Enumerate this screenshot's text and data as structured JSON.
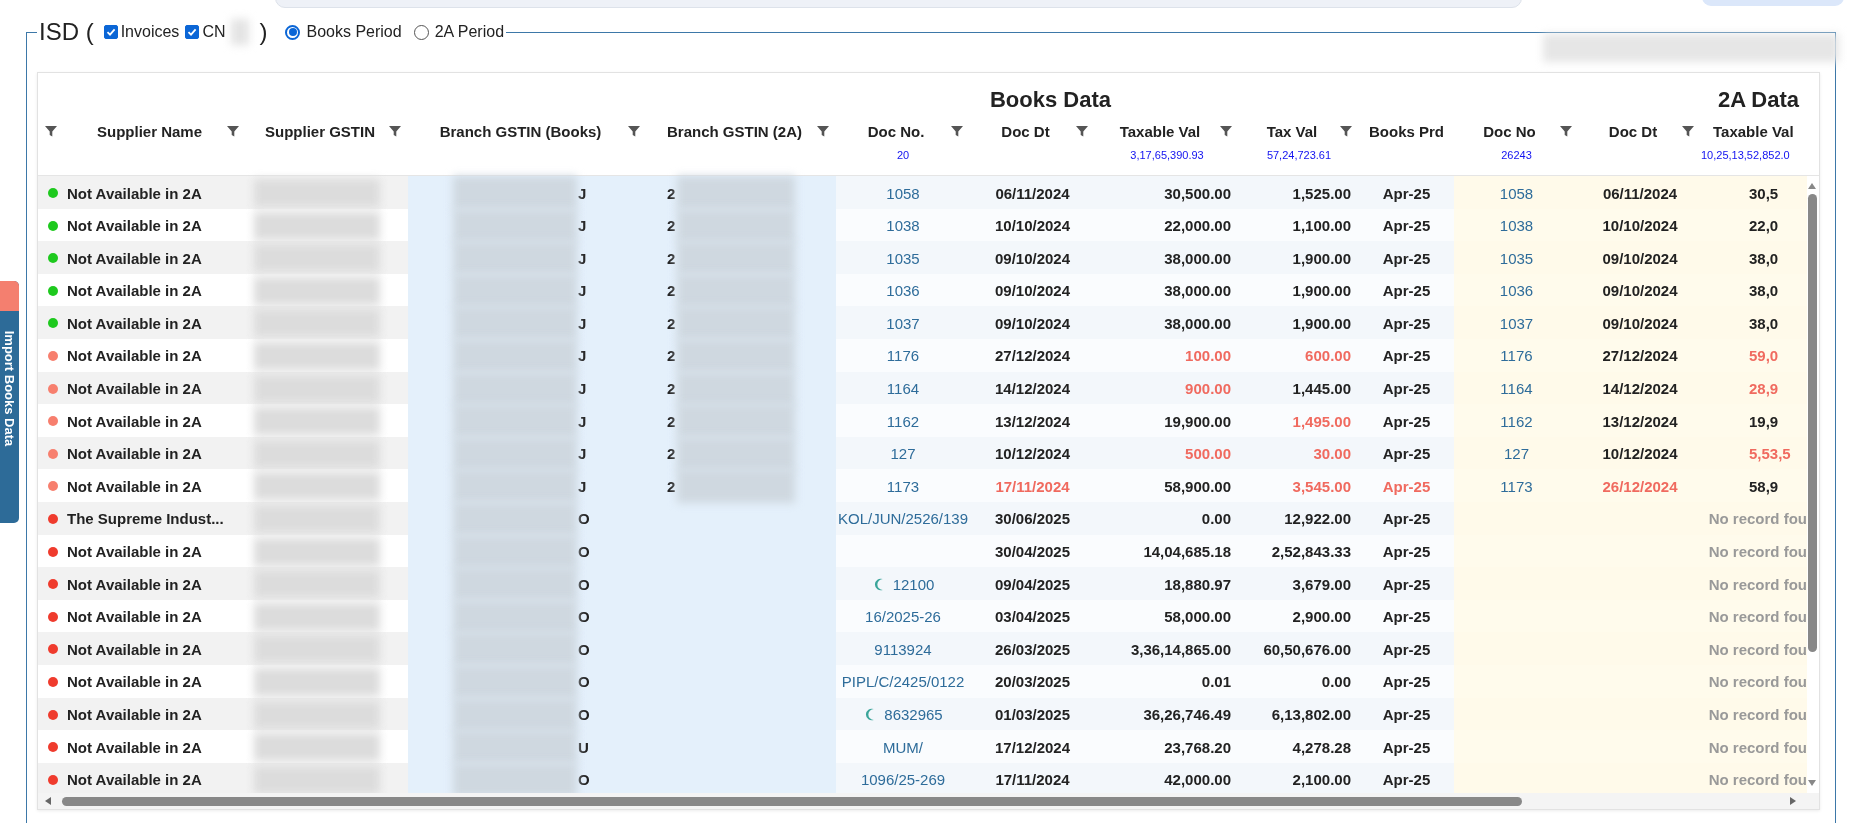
{
  "legend": {
    "title": "ISD (",
    "close": ")",
    "checkboxes": [
      {
        "label": "Invoices",
        "checked": true
      },
      {
        "label": "CN",
        "checked": true
      }
    ],
    "radios": [
      {
        "label": "Books Period",
        "selected": true
      },
      {
        "label": "2A Period",
        "selected": false
      }
    ]
  },
  "side_tab": {
    "label": "Import Books Data"
  },
  "groups": [
    "Books Data",
    "2A Data"
  ],
  "columns": [
    {
      "filter": true
    },
    {
      "label": "Supplier Name",
      "filter": true
    },
    {
      "label": "Supplier GSTIN",
      "filter": true
    },
    {
      "label": "Branch GSTIN (Books)",
      "filter": true
    },
    {
      "label": "Branch GSTIN (2A)",
      "filter": true
    },
    {
      "label": "Doc No.",
      "filter": true,
      "total": "20"
    },
    {
      "label": "Doc Dt",
      "filter": true
    },
    {
      "label": "Taxable Val",
      "filter": true,
      "total": "3,17,65,390.93"
    },
    {
      "label": "Tax Val",
      "filter": true,
      "total": "57,24,723.61"
    },
    {
      "label": "Books Prd",
      "filter": false
    },
    {
      "label": "Doc No",
      "filter": true,
      "total": "26243"
    },
    {
      "label": "Doc Dt",
      "filter": true
    },
    {
      "label": "Taxable Val",
      "filter": false,
      "total": "10,25,13,52,852.0"
    }
  ],
  "rows": [
    {
      "color": "#1ec91e",
      "name": "Not Available in 2A",
      "branch_books_tail": "J",
      "branch_2a_head": "2",
      "doc_no": "1058",
      "flag": false,
      "doc_dt": {
        "text": "06/11/2024",
        "mismatch": false
      },
      "taxable": {
        "text": "30,500.00",
        "mismatch": false
      },
      "tax": {
        "text": "1,525.00",
        "mismatch": false
      },
      "prd": {
        "text": "Apr-25",
        "mismatch": false
      },
      "twoa": {
        "doc_no": "1058",
        "doc_dt": {
          "text": "06/11/2024",
          "mismatch": false
        },
        "taxable": {
          "text": "30,5",
          "mismatch": false
        }
      }
    },
    {
      "color": "#1ec91e",
      "name": "Not Available in 2A",
      "branch_books_tail": "J",
      "branch_2a_head": "2",
      "doc_no": "1038",
      "flag": false,
      "doc_dt": {
        "text": "10/10/2024",
        "mismatch": false
      },
      "taxable": {
        "text": "22,000.00",
        "mismatch": false
      },
      "tax": {
        "text": "1,100.00",
        "mismatch": false
      },
      "prd": {
        "text": "Apr-25",
        "mismatch": false
      },
      "twoa": {
        "doc_no": "1038",
        "doc_dt": {
          "text": "10/10/2024",
          "mismatch": false
        },
        "taxable": {
          "text": "22,0",
          "mismatch": false
        }
      }
    },
    {
      "color": "#1ec91e",
      "name": "Not Available in 2A",
      "branch_books_tail": "J",
      "branch_2a_head": "2",
      "doc_no": "1035",
      "flag": false,
      "doc_dt": {
        "text": "09/10/2024",
        "mismatch": false
      },
      "taxable": {
        "text": "38,000.00",
        "mismatch": false
      },
      "tax": {
        "text": "1,900.00",
        "mismatch": false
      },
      "prd": {
        "text": "Apr-25",
        "mismatch": false
      },
      "twoa": {
        "doc_no": "1035",
        "doc_dt": {
          "text": "09/10/2024",
          "mismatch": false
        },
        "taxable": {
          "text": "38,0",
          "mismatch": false
        }
      }
    },
    {
      "color": "#1ec91e",
      "name": "Not Available in 2A",
      "branch_books_tail": "J",
      "branch_2a_head": "2",
      "doc_no": "1036",
      "flag": false,
      "doc_dt": {
        "text": "09/10/2024",
        "mismatch": false
      },
      "taxable": {
        "text": "38,000.00",
        "mismatch": false
      },
      "tax": {
        "text": "1,900.00",
        "mismatch": false
      },
      "prd": {
        "text": "Apr-25",
        "mismatch": false
      },
      "twoa": {
        "doc_no": "1036",
        "doc_dt": {
          "text": "09/10/2024",
          "mismatch": false
        },
        "taxable": {
          "text": "38,0",
          "mismatch": false
        }
      }
    },
    {
      "color": "#1ec91e",
      "name": "Not Available in 2A",
      "branch_books_tail": "J",
      "branch_2a_head": "2",
      "doc_no": "1037",
      "flag": false,
      "doc_dt": {
        "text": "09/10/2024",
        "mismatch": false
      },
      "taxable": {
        "text": "38,000.00",
        "mismatch": false
      },
      "tax": {
        "text": "1,900.00",
        "mismatch": false
      },
      "prd": {
        "text": "Apr-25",
        "mismatch": false
      },
      "twoa": {
        "doc_no": "1037",
        "doc_dt": {
          "text": "09/10/2024",
          "mismatch": false
        },
        "taxable": {
          "text": "38,0",
          "mismatch": false
        }
      }
    },
    {
      "color": "#f77f6e",
      "name": "Not Available in 2A",
      "branch_books_tail": "J",
      "branch_2a_head": "2",
      "doc_no": "1176",
      "flag": false,
      "doc_dt": {
        "text": "27/12/2024",
        "mismatch": false
      },
      "taxable": {
        "text": "100.00",
        "mismatch": true
      },
      "tax": {
        "text": "600.00",
        "mismatch": true
      },
      "prd": {
        "text": "Apr-25",
        "mismatch": false
      },
      "twoa": {
        "doc_no": "1176",
        "doc_dt": {
          "text": "27/12/2024",
          "mismatch": false
        },
        "taxable": {
          "text": "59,0",
          "mismatch": true
        }
      }
    },
    {
      "color": "#f77f6e",
      "name": "Not Available in 2A",
      "branch_books_tail": "J",
      "branch_2a_head": "2",
      "doc_no": "1164",
      "flag": false,
      "doc_dt": {
        "text": "14/12/2024",
        "mismatch": false
      },
      "taxable": {
        "text": "900.00",
        "mismatch": true
      },
      "tax": {
        "text": "1,445.00",
        "mismatch": false
      },
      "prd": {
        "text": "Apr-25",
        "mismatch": false
      },
      "twoa": {
        "doc_no": "1164",
        "doc_dt": {
          "text": "14/12/2024",
          "mismatch": false
        },
        "taxable": {
          "text": "28,9",
          "mismatch": true
        }
      }
    },
    {
      "color": "#f77f6e",
      "name": "Not Available in 2A",
      "branch_books_tail": "J",
      "branch_2a_head": "2",
      "doc_no": "1162",
      "flag": false,
      "doc_dt": {
        "text": "13/12/2024",
        "mismatch": false
      },
      "taxable": {
        "text": "19,900.00",
        "mismatch": false
      },
      "tax": {
        "text": "1,495.00",
        "mismatch": true
      },
      "prd": {
        "text": "Apr-25",
        "mismatch": false
      },
      "twoa": {
        "doc_no": "1162",
        "doc_dt": {
          "text": "13/12/2024",
          "mismatch": false
        },
        "taxable": {
          "text": "19,9",
          "mismatch": false
        }
      }
    },
    {
      "color": "#f77f6e",
      "name": "Not Available in 2A",
      "branch_books_tail": "J",
      "branch_2a_head": "2",
      "doc_no": "127",
      "flag": false,
      "doc_dt": {
        "text": "10/12/2024",
        "mismatch": false
      },
      "taxable": {
        "text": "500.00",
        "mismatch": true
      },
      "tax": {
        "text": "30.00",
        "mismatch": true
      },
      "prd": {
        "text": "Apr-25",
        "mismatch": false
      },
      "twoa": {
        "doc_no": "127",
        "doc_dt": {
          "text": "10/12/2024",
          "mismatch": false
        },
        "taxable": {
          "text": "5,53,5",
          "mismatch": true
        }
      }
    },
    {
      "color": "#f77f6e",
      "name": "Not Available in 2A",
      "branch_books_tail": "J",
      "branch_2a_head": "2",
      "doc_no": "1173",
      "flag": false,
      "doc_dt": {
        "text": "17/11/2024",
        "mismatch": true
      },
      "taxable": {
        "text": "58,900.00",
        "mismatch": false
      },
      "tax": {
        "text": "3,545.00",
        "mismatch": true
      },
      "prd": {
        "text": "Apr-25",
        "mismatch": true
      },
      "twoa": {
        "doc_no": "1173",
        "doc_dt": {
          "text": "26/12/2024",
          "mismatch": true
        },
        "taxable": {
          "text": "58,9",
          "mismatch": false
        }
      }
    },
    {
      "color": "#ef3b2d",
      "name": "The Supreme Indust...",
      "branch_books_tail": "O",
      "doc_no": "KOL/JUN/2526/139",
      "flag": false,
      "doc_dt": {
        "text": "30/06/2025",
        "mismatch": false
      },
      "taxable": {
        "text": "0.00",
        "mismatch": false
      },
      "tax": {
        "text": "12,922.00",
        "mismatch": false
      },
      "prd": {
        "text": "Apr-25",
        "mismatch": false
      },
      "twoa_note": "No record fou"
    },
    {
      "color": "#ef3b2d",
      "name": "Not Available in 2A",
      "branch_books_tail": "O",
      "flag": false,
      "doc_dt": {
        "text": "30/04/2025",
        "mismatch": false
      },
      "taxable": {
        "text": "14,04,685.18",
        "mismatch": false
      },
      "tax": {
        "text": "2,52,843.33",
        "mismatch": false
      },
      "prd": {
        "text": "Apr-25",
        "mismatch": false
      },
      "twoa_note": "No record fou"
    },
    {
      "color": "#ef3b2d",
      "name": "Not Available in 2A",
      "branch_books_tail": "O",
      "doc_no": "12100",
      "flag": true,
      "doc_dt": {
        "text": "09/04/2025",
        "mismatch": false
      },
      "taxable": {
        "text": "18,880.97",
        "mismatch": false
      },
      "tax": {
        "text": "3,679.00",
        "mismatch": false
      },
      "prd": {
        "text": "Apr-25",
        "mismatch": false
      },
      "twoa_note": "No record fou"
    },
    {
      "color": "#ef3b2d",
      "name": "Not Available in 2A",
      "branch_books_tail": "O",
      "doc_no": "16/2025-26",
      "flag": false,
      "doc_dt": {
        "text": "03/04/2025",
        "mismatch": false
      },
      "taxable": {
        "text": "58,000.00",
        "mismatch": false
      },
      "tax": {
        "text": "2,900.00",
        "mismatch": false
      },
      "prd": {
        "text": "Apr-25",
        "mismatch": false
      },
      "twoa_note": "No record fou"
    },
    {
      "color": "#ef3b2d",
      "name": "Not Available in 2A",
      "branch_books_tail": "O",
      "doc_no": "9113924",
      "flag": false,
      "doc_dt": {
        "text": "26/03/2025",
        "mismatch": false
      },
      "taxable": {
        "text": "3,36,14,865.00",
        "mismatch": false
      },
      "tax": {
        "text": "60,50,676.00",
        "mismatch": false
      },
      "prd": {
        "text": "Apr-25",
        "mismatch": false
      },
      "twoa_note": "No record fou"
    },
    {
      "color": "#ef3b2d",
      "name": "Not Available in 2A",
      "branch_books_tail": "O",
      "doc_no": "PIPL/C/2425/0122",
      "flag": false,
      "doc_dt": {
        "text": "20/03/2025",
        "mismatch": false
      },
      "taxable": {
        "text": "0.01",
        "mismatch": false
      },
      "tax": {
        "text": "0.00",
        "mismatch": false
      },
      "prd": {
        "text": "Apr-25",
        "mismatch": false
      },
      "twoa_note": "No record fou"
    },
    {
      "color": "#ef3b2d",
      "name": "Not Available in 2A",
      "branch_books_tail": "O",
      "doc_no": "8632965",
      "flag": true,
      "doc_dt": {
        "text": "01/03/2025",
        "mismatch": false
      },
      "taxable": {
        "text": "36,26,746.49",
        "mismatch": false
      },
      "tax": {
        "text": "6,13,802.00",
        "mismatch": false
      },
      "prd": {
        "text": "Apr-25",
        "mismatch": false
      },
      "twoa_note": "No record fou"
    },
    {
      "color": "#ef3b2d",
      "name": "Not Available in 2A",
      "branch_books_tail": "U",
      "doc_no": "MUM/",
      "flag": false,
      "doc_dt": {
        "text": "17/12/2024",
        "mismatch": false
      },
      "taxable": {
        "text": "23,768.20",
        "mismatch": false
      },
      "tax": {
        "text": "4,278.28",
        "mismatch": false
      },
      "prd": {
        "text": "Apr-25",
        "mismatch": false
      },
      "twoa_note": "No record fou"
    },
    {
      "color": "#ef3b2d",
      "name": "Not Available in 2A",
      "branch_books_tail": "O",
      "doc_no": "1096/25-269",
      "flag": false,
      "doc_dt": {
        "text": "17/11/2024",
        "mismatch": false
      },
      "taxable": {
        "text": "42,000.00",
        "mismatch": false
      },
      "tax": {
        "text": "2,100.00",
        "mismatch": false
      },
      "prd": {
        "text": "Apr-25",
        "mismatch": false
      },
      "twoa_note": "No record fou"
    }
  ]
}
